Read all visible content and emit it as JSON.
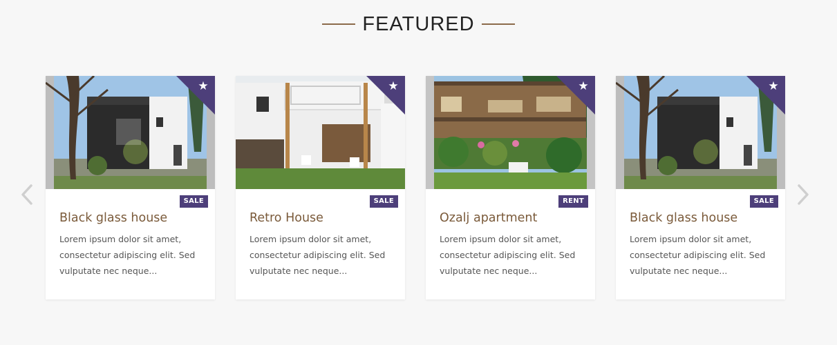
{
  "section": {
    "title": "FEATURED"
  },
  "colors": {
    "accent": "#4d3f7a",
    "title_brown": "#7a5a3a",
    "divider": "#8b6a4a",
    "background": "#f7f7f7"
  },
  "icons": {
    "prev": "chevron-left-icon",
    "next": "chevron-right-icon",
    "featured": "star-icon"
  },
  "cards": [
    {
      "badge": "SALE",
      "title": "Black glass house",
      "description": "Lorem ipsum dolor sit amet, consectetur adipiscing elit. Sed vulputate nec neque...",
      "star": "★"
    },
    {
      "badge": "SALE",
      "title": "Retro House",
      "description": "Lorem ipsum dolor sit amet, consectetur adipiscing elit. Sed vulputate nec neque...",
      "star": "★"
    },
    {
      "badge": "RENT",
      "title": "Ozalj apartment",
      "description": "Lorem ipsum dolor sit amet, consectetur adipiscing elit. Sed vulputate nec neque...",
      "star": "★"
    },
    {
      "badge": "SALE",
      "title": "Black glass house",
      "description": "Lorem ipsum dolor sit amet, consectetur adipiscing elit. Sed vulputate nec neque...",
      "star": "★"
    }
  ]
}
